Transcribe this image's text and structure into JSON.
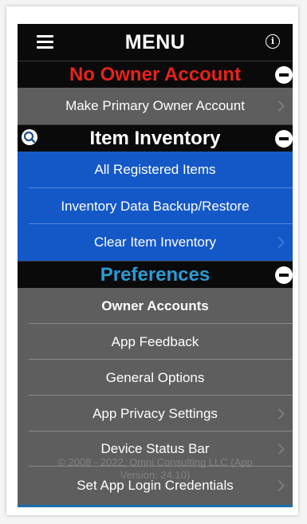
{
  "header": {
    "title": "MENU",
    "menu_icon": "hamburger-menu-icon",
    "info_icon": "info-icon",
    "info_glyph": "i"
  },
  "colors": {
    "no_owner_red": "#e8221c",
    "item_inventory_white": "#ffffff",
    "preferences_blue": "#2a9bd6",
    "row_blue": "#1458c8",
    "row_gray": "#5e5e5e"
  },
  "sections": {
    "no_owner": {
      "label": "No Owner Account",
      "rows": [
        "Make Primary Owner Account"
      ]
    },
    "item_inventory": {
      "label": "Item Inventory",
      "rows": [
        "All Registered Items",
        "Inventory Data Backup/Restore",
        "Clear Item Inventory"
      ]
    },
    "preferences": {
      "label": "Preferences",
      "rows": [
        "Owner Accounts",
        "App Feedback",
        "General Options",
        "App Privacy Settings",
        "Device Status Bar",
        "Set App Login Credentials"
      ]
    }
  },
  "footer": {
    "copyright": "© 2008 - 2022, Omni Consulting LLC (App",
    "version": "Version: 24.10)"
  }
}
